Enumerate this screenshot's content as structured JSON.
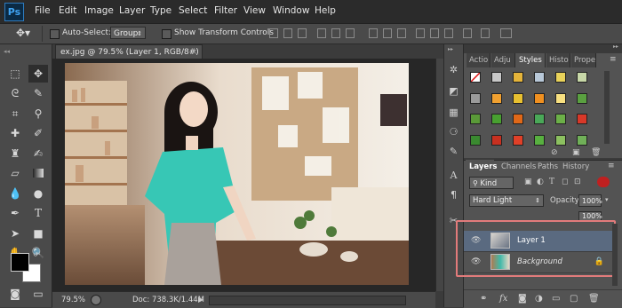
{
  "app": {
    "logo": "Ps"
  },
  "menu": [
    "File",
    "Edit",
    "Image",
    "Layer",
    "Type",
    "Select",
    "Filter",
    "View",
    "Window",
    "Help"
  ],
  "options_bar": {
    "auto_select_label": "Auto-Select:",
    "auto_select_value": "Group",
    "show_transform_label": "Show Transform Controls"
  },
  "document": {
    "tab_title": "ex.jpg @ 79.5% (Layer 1, RGB/8#) *",
    "close_glyph": "×",
    "zoom": "79.5%",
    "doc_size": "Doc: 738.3K/1.44M"
  },
  "styles_panel": {
    "tabs": [
      "Actio",
      "Adju",
      "Styles",
      "Histo",
      "Prope"
    ],
    "active_tab": "Styles"
  },
  "layers_panel": {
    "tabs": [
      "Layers",
      "Channels",
      "Paths",
      "History"
    ],
    "active_tab": "Layers",
    "filter_kind": "Kind",
    "blend_mode": "Hard Light",
    "opacity_label": "Opacity:",
    "opacity_value": "100%",
    "fill_value": "100%",
    "layers": [
      {
        "name": "Layer 1",
        "selected": true,
        "italic": false
      },
      {
        "name": "Background",
        "selected": false,
        "italic": true,
        "locked": true
      }
    ]
  },
  "colors": {
    "foreground": "#000000",
    "background": "#ffffff",
    "highlight_border": "#e27b7b",
    "selected_layer": "#5a6a80"
  },
  "icons": {
    "toolbar": [
      "move-icon",
      "marquee-icon",
      "lasso-icon",
      "quick-select-icon",
      "crop-icon",
      "eyedropper-icon",
      "healing-brush-icon",
      "brush-icon",
      "clone-stamp-icon",
      "history-brush-icon",
      "eraser-icon",
      "gradient-icon",
      "blur-icon",
      "dodge-icon",
      "pen-icon",
      "type-icon",
      "path-select-icon",
      "rectangle-icon",
      "hand-icon",
      "zoom-icon"
    ],
    "dock": [
      "navigator-icon",
      "color-icon",
      "swatches-icon",
      "info-icon",
      "brush-presets-icon",
      "character-icon",
      "paragraph-icon",
      "tools-icon"
    ],
    "layers_footer": [
      "link-icon",
      "fx-icon",
      "mask-icon",
      "adjustment-icon",
      "folder-icon",
      "new-layer-icon",
      "trash-icon"
    ]
  }
}
